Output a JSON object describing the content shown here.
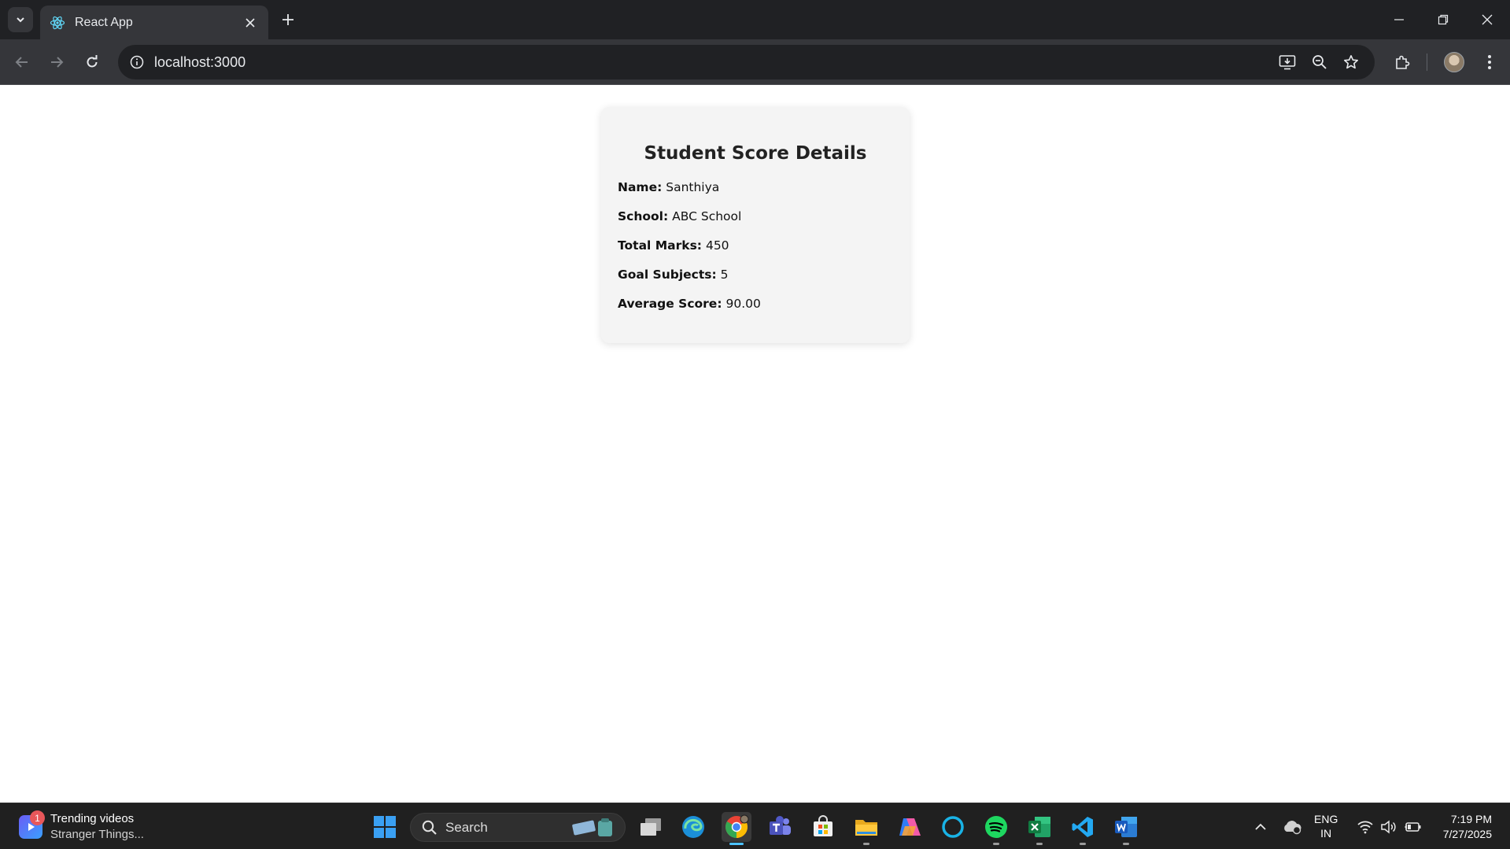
{
  "browser": {
    "tab_title": "React App",
    "url": "localhost:3000"
  },
  "card": {
    "title": "Student Score Details",
    "fields": [
      {
        "label": "Name:",
        "value": "Santhiya"
      },
      {
        "label": "School:",
        "value": "ABC School"
      },
      {
        "label": "Total Marks:",
        "value": "450"
      },
      {
        "label": "Goal Subjects:",
        "value": "5"
      },
      {
        "label": "Average Score:",
        "value": "90.00"
      }
    ]
  },
  "taskbar": {
    "widget_title": "Trending videos",
    "widget_subtitle": "Stranger Things...",
    "widget_badge": "1",
    "search_label": "Search",
    "lang_line1": "ENG",
    "lang_line2": "IN",
    "time": "7:19 PM",
    "date": "7/27/2025"
  },
  "colors": {
    "chrome_dark": "#202124",
    "chrome_toolbar": "#35363a",
    "card_bg": "#f4f4f4",
    "taskbar_bg": "#202020",
    "accent": "#4cc2ff"
  }
}
